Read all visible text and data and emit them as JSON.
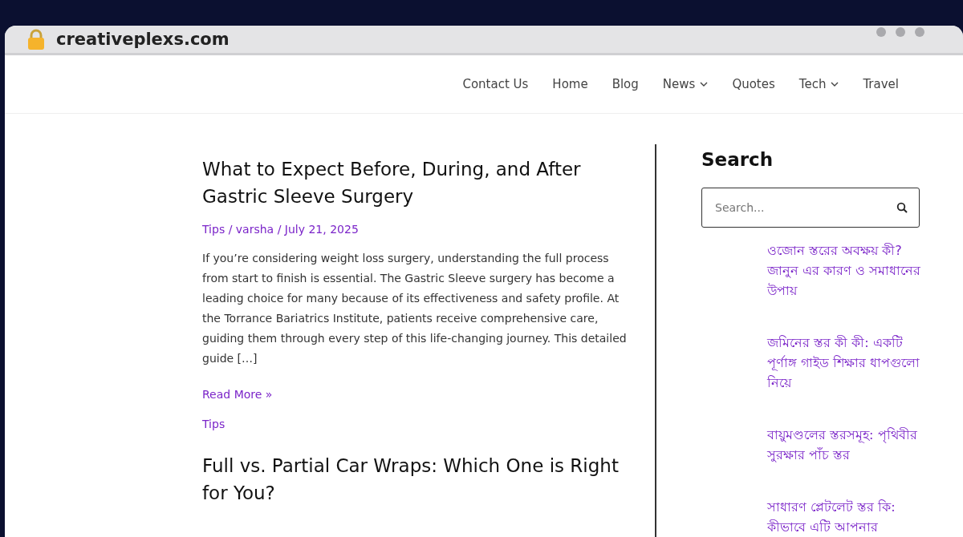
{
  "browser": {
    "url": "creativeplexs.com"
  },
  "nav": [
    {
      "label": "Contact Us",
      "has_submenu": false
    },
    {
      "label": "Home",
      "has_submenu": false
    },
    {
      "label": "Blog",
      "has_submenu": false
    },
    {
      "label": "News",
      "has_submenu": true
    },
    {
      "label": "Quotes",
      "has_submenu": false
    },
    {
      "label": "Tech",
      "has_submenu": true
    },
    {
      "label": "Travel",
      "has_submenu": false
    }
  ],
  "posts": [
    {
      "title": "What to Expect Before, During, and After Gastric Sleeve Surgery",
      "meta": [
        "Tips",
        "varsha",
        "July 21, 2025"
      ],
      "meta_separator": " / ",
      "excerpt": "If you’re considering weight loss surgery, understanding the full process from start to finish is essential. The Gastric Sleeve surgery has become a leading choice for many because of its effectiveness and safety profile. At the Torrance Bariatrics Institute, patients receive comprehensive care, guiding them through every step of this life-changing journey. This detailed guide […]",
      "read_more": "Read More »",
      "category": "Tips"
    },
    {
      "title": "Full vs. Partial Car Wraps: Which One is Right for You?"
    }
  ],
  "sidebar": {
    "heading": "Search",
    "search": {
      "placeholder": "Search..."
    },
    "links": [
      "ওজোন স্তরের অবক্ষয় কী? জানুন এর কারণ ও সমাধানের উপায়",
      "জমিনের স্তর কী কী: একটি পূর্ণাঙ্গ গাইড শিক্ষার ধাপগুলো নিয়ে",
      "বায়ুমণ্ডলের স্তরসমূহ: পৃথিবীর সুরক্ষার পাঁচ স্তর",
      "সাধারণ প্লেটলেট স্তর কি: কীভাবে এটি আপনার"
    ]
  }
}
